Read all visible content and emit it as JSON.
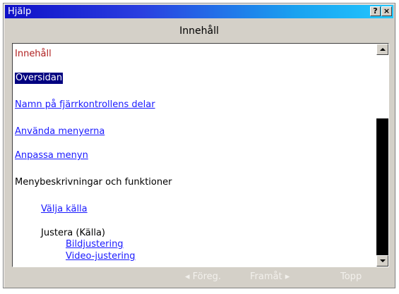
{
  "window": {
    "title": "Hjälp",
    "help_glyph": "?",
    "close_glyph": "×"
  },
  "header": {
    "title": "Innehåll"
  },
  "toc": {
    "items": [
      {
        "label": "Innehåll"
      },
      {
        "label": "Översidan"
      },
      {
        "label": "Namn på fjärrkontrollens delar"
      },
      {
        "label": "Använda menyerna"
      },
      {
        "label": "Anpassa menyn"
      },
      {
        "label": "Menybeskrivningar och funktioner"
      },
      {
        "label": "Välja källa"
      },
      {
        "label": "Justera (Källa)"
      },
      {
        "label": "Bildjustering"
      },
      {
        "label": "Video-justering"
      }
    ]
  },
  "footer": {
    "prev_label": "◂ Föreg.",
    "next_label": "Framåt ▸",
    "top_label": "Topp"
  }
}
